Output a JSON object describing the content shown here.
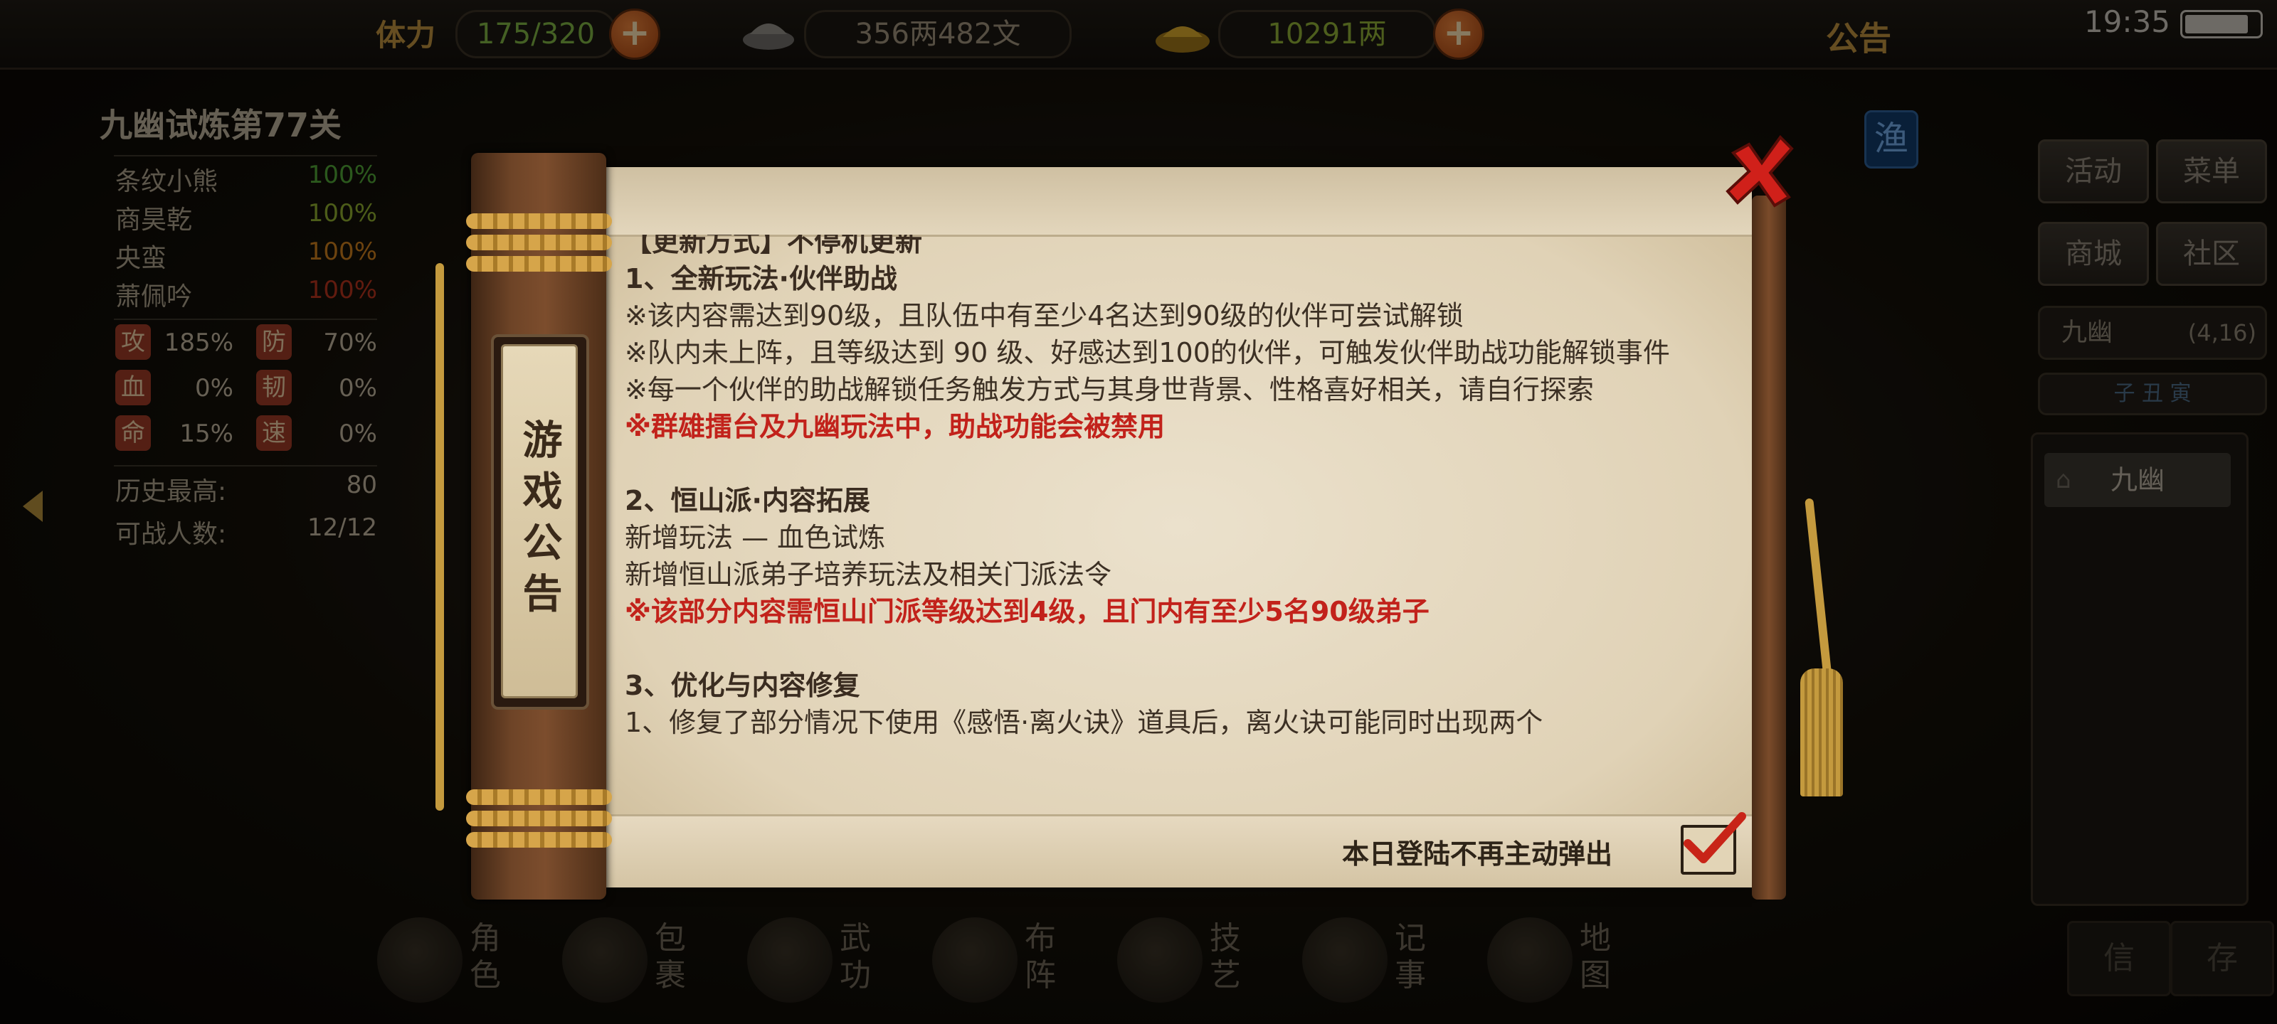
{
  "top": {
    "stamina_label": "体力",
    "stamina_value": "175/320",
    "silver_value": "356两482文",
    "gold_value": "10291两",
    "notice_label": "公告",
    "time": "19:35"
  },
  "left_panel": {
    "title": "九幽试炼第77关",
    "partners": [
      {
        "name": "条纹小熊",
        "hp": "100%",
        "color": "#4fa035"
      },
      {
        "name": "商昊乾",
        "hp": "100%",
        "color": "#8aa82e"
      },
      {
        "name": "央蛮",
        "hp": "100%",
        "color": "#c67a1c"
      },
      {
        "name": "萧佩吟",
        "hp": "100%",
        "color": "#b1321d"
      }
    ],
    "attributes": [
      {
        "label": "攻",
        "value": "185%"
      },
      {
        "label": "防",
        "value": "70%"
      },
      {
        "label": "血",
        "value": "0%"
      },
      {
        "label": "韧",
        "value": "0%"
      },
      {
        "label": "命",
        "value": "15%"
      },
      {
        "label": "速",
        "value": "0%"
      }
    ],
    "history_label": "历史最高:",
    "history_value": "80",
    "fighters_label": "可战人数:",
    "fighters_value": "12/12"
  },
  "right_panel": {
    "fish": "渔",
    "buttons": [
      "活动",
      "菜单",
      "商城",
      "社区"
    ],
    "location_name": "九幽",
    "location_coord": "(4,16)",
    "time_chars": "子  丑  寅",
    "list_item": "九幽",
    "bottom_buttons": [
      "信",
      "存"
    ]
  },
  "bottom_nav": [
    {
      "label": "角色",
      "icon": "character-icon"
    },
    {
      "label": "包裹",
      "icon": "bag-icon"
    },
    {
      "label": "武功",
      "icon": "martial-arts-icon"
    },
    {
      "label": "布阵",
      "icon": "formation-icon"
    },
    {
      "label": "技艺",
      "icon": "skills-icon"
    },
    {
      "label": "记事",
      "icon": "journal-icon"
    },
    {
      "label": "地图",
      "icon": "map-icon"
    }
  ],
  "notice": {
    "tag": "游戏公告",
    "lines": [
      {
        "text": "【更新方式】不停机更新",
        "style": "head"
      },
      {
        "text": "1、全新玩法·伙伴助战",
        "style": "head"
      },
      {
        "text": "※该内容需达到90级，且队伍中有至少4名达到90级的伙伴可尝试解锁",
        "style": "normal"
      },
      {
        "text": "※队内未上阵，且等级达到 90 级、好感达到100的伙伴，可触发伙伴助战功能解锁事件",
        "style": "normal"
      },
      {
        "text": "※每一个伙伴的助战解锁任务触发方式与其身世背景、性格喜好相关，请自行探索",
        "style": "normal"
      },
      {
        "text": "※群雄擂台及九幽玩法中，助战功能会被禁用",
        "style": "red"
      },
      {
        "text": "",
        "style": "gap"
      },
      {
        "text": "2、恒山派·内容拓展",
        "style": "head"
      },
      {
        "text": "新增玩法 — 血色试炼",
        "style": "normal"
      },
      {
        "text": "新增恒山派弟子培养玩法及相关门派法令",
        "style": "normal"
      },
      {
        "text": "※该部分内容需恒山门派等级达到4级，且门内有至少5名90级弟子",
        "style": "red"
      },
      {
        "text": "",
        "style": "gap"
      },
      {
        "text": "3、优化与内容修复",
        "style": "head"
      },
      {
        "text": "1、修复了部分情况下使用《感悟·离火诀》道具后，离火诀可能同时出现两个",
        "style": "normal"
      }
    ],
    "optout_label": "本日登陆不再主动弹出"
  }
}
